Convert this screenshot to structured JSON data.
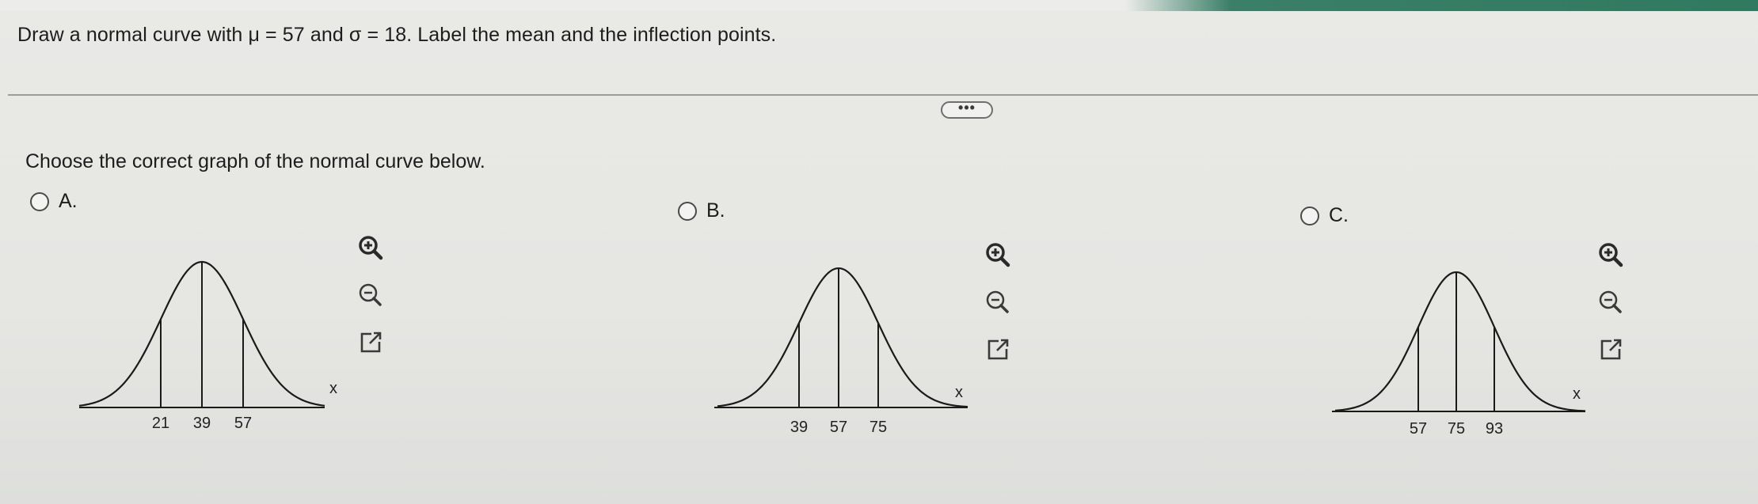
{
  "question": {
    "text": "Draw a normal curve with μ = 57 and σ = 18. Label the mean and the inflection points."
  },
  "more_button": {
    "label": "•••"
  },
  "prompt": {
    "text": "Choose the correct graph of the normal curve below."
  },
  "options": [
    {
      "letter": "A.",
      "ticks": [
        "21",
        "39",
        "57"
      ],
      "x_label": "x",
      "tools": [
        "zoom-in-icon",
        "zoom-out-icon",
        "open-external-icon"
      ]
    },
    {
      "letter": "B.",
      "ticks": [
        "39",
        "57",
        "75"
      ],
      "x_label": "x",
      "tools": [
        "zoom-in-icon",
        "zoom-out-icon",
        "open-external-icon"
      ]
    },
    {
      "letter": "C.",
      "ticks": [
        "57",
        "75",
        "93"
      ],
      "x_label": "x",
      "tools": [
        "zoom-in-icon",
        "zoom-out-icon",
        "open-external-icon"
      ]
    }
  ],
  "colors": {
    "header_accent": "#2f7a60",
    "background": "#e6e6e3",
    "curve": "#1a1a1a"
  }
}
